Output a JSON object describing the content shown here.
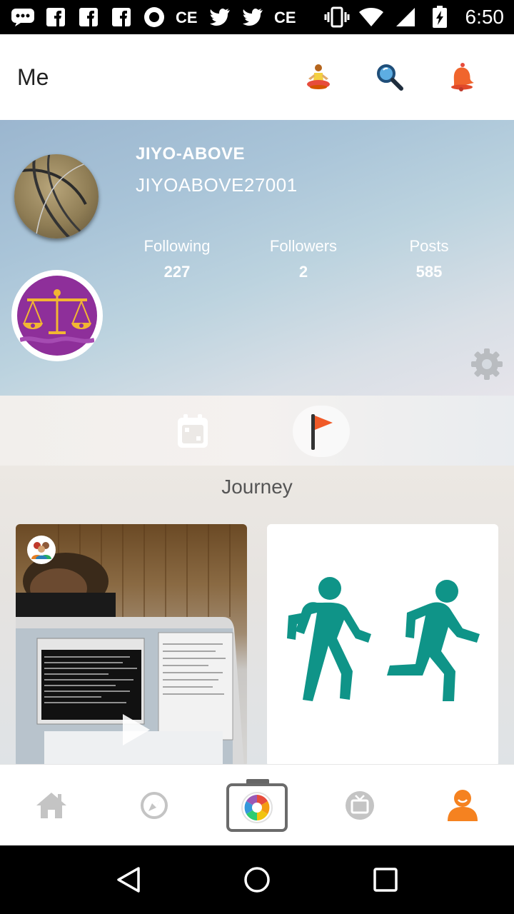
{
  "status_bar": {
    "time": "6:50",
    "notification_icons": [
      "chat-bubble-icon",
      "facebook-icon",
      "facebook-icon",
      "facebook-icon",
      "record-icon",
      "app-ce-icon",
      "twitter-icon",
      "twitter-icon",
      "app-ce-icon"
    ],
    "system_icons": [
      "vibrate-icon",
      "wifi-icon",
      "signal-icon",
      "battery-charging-icon"
    ]
  },
  "header": {
    "title": "Me",
    "actions": [
      "meditation-icon",
      "search-icon",
      "bell-icon"
    ]
  },
  "profile": {
    "display_name": "JIYO-ABOVE",
    "user_id": "JIYOABOVE27001",
    "zodiac": "libra",
    "stats": [
      {
        "label": "Following",
        "value": "227"
      },
      {
        "label": "Followers",
        "value": "2"
      },
      {
        "label": "Posts",
        "value": "585"
      }
    ]
  },
  "tabs": [
    {
      "icon": "calendar-icon",
      "active": false
    },
    {
      "icon": "flag-icon",
      "active": true
    }
  ],
  "section": {
    "title": "Journey"
  },
  "cards": [
    {
      "type": "video",
      "badge": "group-icon"
    },
    {
      "type": "activity",
      "icon": "walk-run-icon"
    }
  ],
  "bottom_nav": [
    {
      "icon": "home-icon",
      "active": false
    },
    {
      "icon": "compass-icon",
      "active": false
    },
    {
      "icon": "camera-icon",
      "active": false
    },
    {
      "icon": "tv-icon",
      "active": false
    },
    {
      "icon": "profile-icon",
      "active": true
    }
  ],
  "colors": {
    "accent": "#f58220",
    "teal": "#0f9488",
    "zodiac_purple": "#8e2f9a",
    "zodiac_gold": "#f2b632",
    "nav_inactive": "#c4c4c4"
  }
}
